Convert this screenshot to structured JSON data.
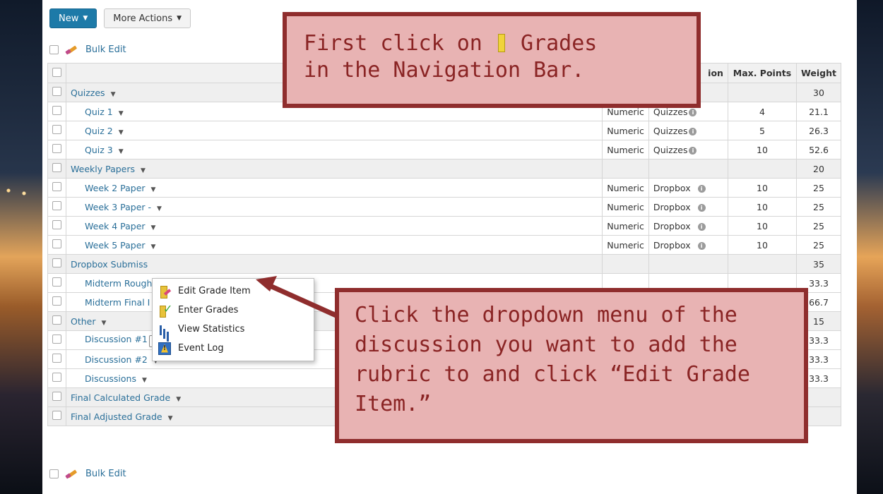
{
  "toolbar": {
    "new_label": "New",
    "more_actions_label": "More Actions"
  },
  "bulk_edit": {
    "label": "Bulk Edit"
  },
  "table": {
    "headers": {
      "association": "ion",
      "max_points": "Max. Points",
      "weight": "Weight"
    },
    "rows": [
      {
        "name": "Quizzes",
        "type": "",
        "assoc": "",
        "max": "",
        "weight": "30"
      },
      {
        "name": "Quiz 1",
        "type": "Numeric",
        "assoc": "Quizzes",
        "max": "4",
        "weight": "21.1"
      },
      {
        "name": "Quiz 2",
        "type": "Numeric",
        "assoc": "Quizzes",
        "max": "5",
        "weight": "26.3"
      },
      {
        "name": "Quiz 3",
        "type": "Numeric",
        "assoc": "Quizzes",
        "max": "10",
        "weight": "52.6"
      },
      {
        "name": "Weekly Papers",
        "type": "",
        "assoc": "",
        "max": "",
        "weight": "20"
      },
      {
        "name": "Week 2 Paper",
        "type": "Numeric",
        "assoc": "Dropbox",
        "max": "10",
        "weight": "25"
      },
      {
        "name": "Week 3 Paper -",
        "type": "Numeric",
        "assoc": "Dropbox",
        "max": "10",
        "weight": "25"
      },
      {
        "name": "Week 4 Paper",
        "type": "Numeric",
        "assoc": "Dropbox",
        "max": "10",
        "weight": "25"
      },
      {
        "name": "Week 5 Paper",
        "type": "Numeric",
        "assoc": "Dropbox",
        "max": "10",
        "weight": "25"
      },
      {
        "name": "Dropbox Submiss",
        "type": "",
        "assoc": "",
        "max": "",
        "weight": "35"
      },
      {
        "name": "Midterm Rough",
        "type": "",
        "assoc": "",
        "max": "",
        "weight": "33.3"
      },
      {
        "name": "Midterm Final I",
        "type": "",
        "assoc": "",
        "max": "",
        "weight": "66.7"
      },
      {
        "name": "Other",
        "type": "",
        "assoc": "",
        "max": "",
        "weight": "15"
      },
      {
        "name": "Discussion #1",
        "type": "",
        "assoc": "",
        "max": "",
        "weight": "33.3"
      },
      {
        "name": "Discussion #2",
        "type": "",
        "assoc": "",
        "max": "",
        "weight": "33.3"
      },
      {
        "name": "Discussions",
        "type": "",
        "assoc": "",
        "max": "",
        "weight": "33.3"
      },
      {
        "name": "Final Calculated Grade",
        "type": "",
        "assoc": "",
        "max": "",
        "weight": ""
      },
      {
        "name": "Final Adjusted Grade",
        "type": "",
        "assoc": "",
        "max": "",
        "weight": ""
      }
    ]
  },
  "context_menu": {
    "items": [
      "Edit Grade Item",
      "Enter Grades",
      "View Statistics",
      "Event Log"
    ]
  },
  "callouts": {
    "first": {
      "line1_a": "First click on",
      "line1_b": "Grades",
      "line2": "in the Navigation Bar."
    },
    "second": "Click the dropdown menu of the discussion you want to add the rubric to and click “Edit Grade Item.”"
  },
  "colors": {
    "accent_button": "#1d7aa8",
    "link": "#2a6f99",
    "callout_fill": "#e8b3b3",
    "callout_border": "#8f2d2d"
  }
}
